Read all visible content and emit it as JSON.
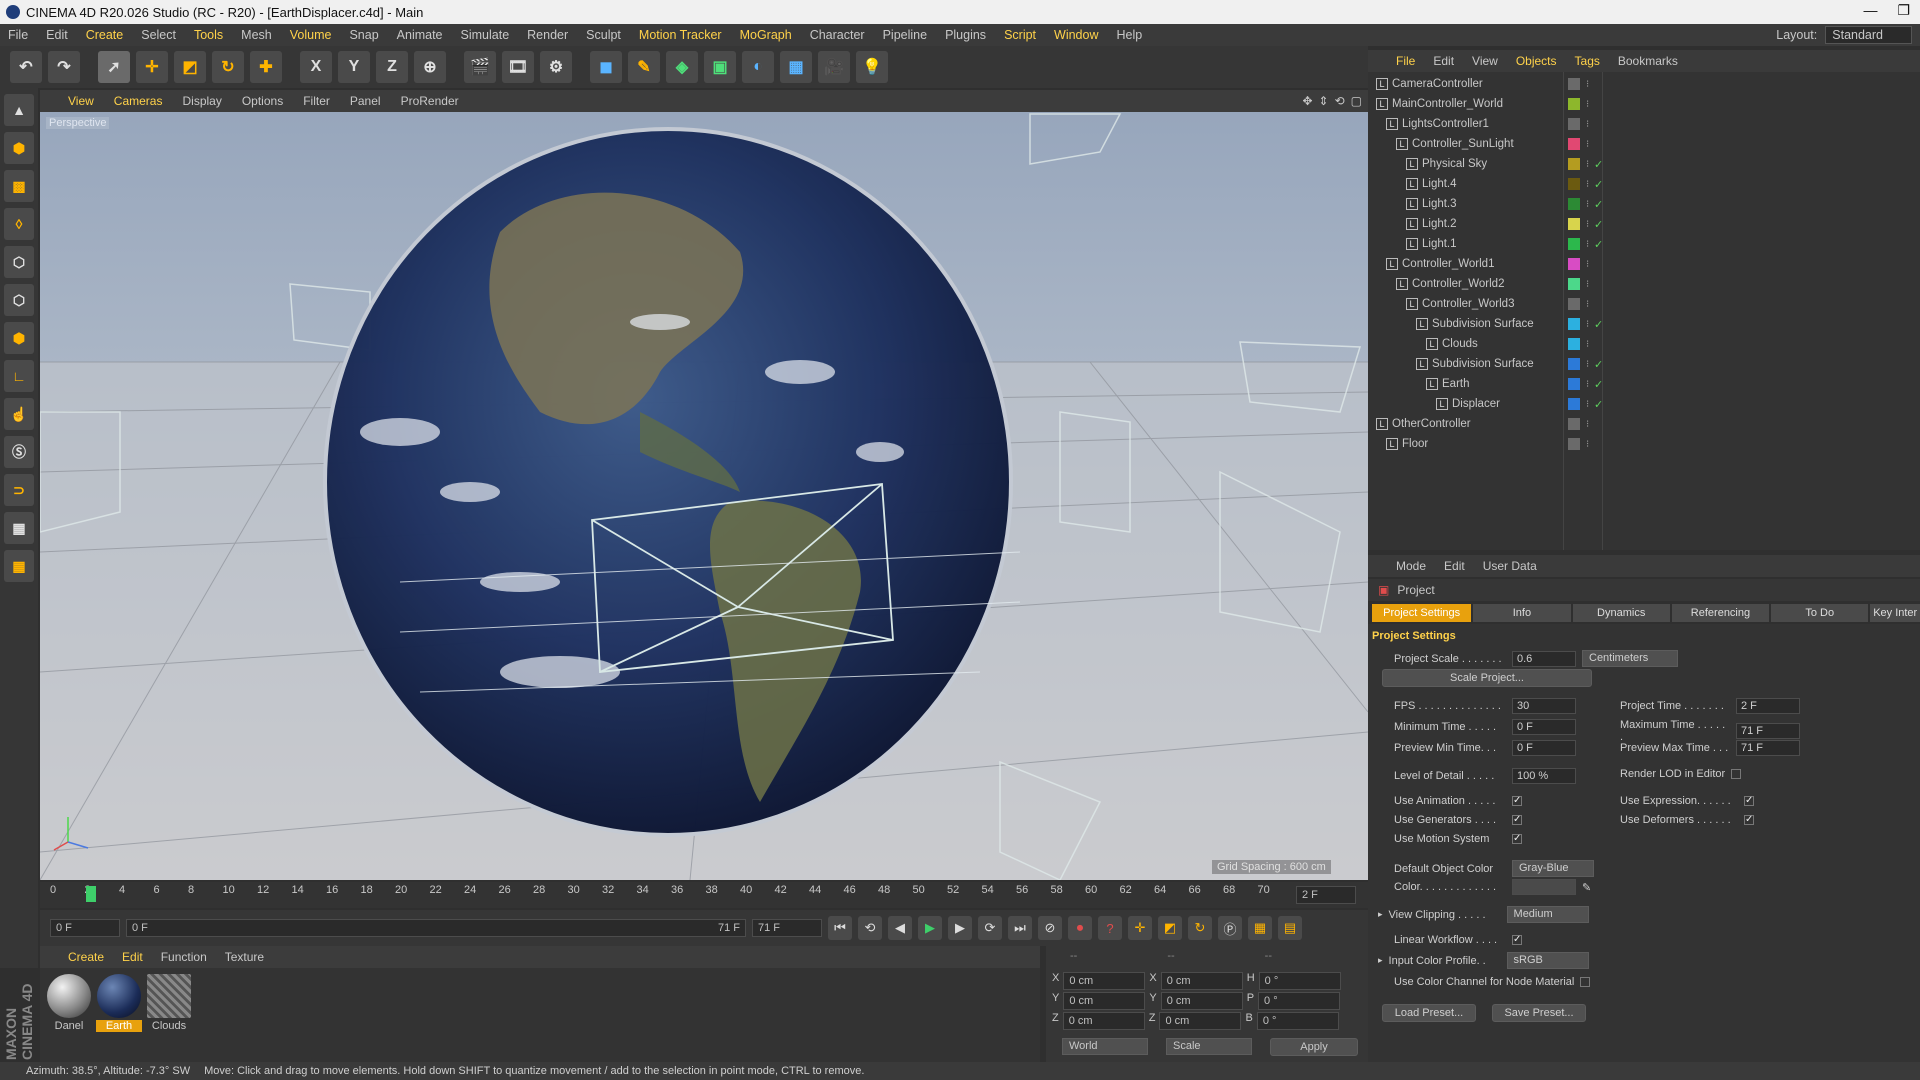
{
  "window": {
    "title": "CINEMA 4D R20.026 Studio (RC - R20) - [EarthDisplacer.c4d] - Main",
    "minimize": "—",
    "maximize": "❐"
  },
  "menubar": {
    "items": [
      "File",
      "Edit",
      "Create",
      "Select",
      "Tools",
      "Mesh",
      "Volume",
      "Snap",
      "Animate",
      "Simulate",
      "Render",
      "Sculpt",
      "Motion Tracker",
      "MoGraph",
      "Character",
      "Pipeline",
      "Plugins",
      "Script",
      "Window",
      "Help"
    ],
    "layout_label": "Layout:",
    "layout_value": "Standard"
  },
  "toolbar": {
    "x": "X",
    "y": "Y",
    "z": "Z"
  },
  "viewport": {
    "menu": [
      "View",
      "Cameras",
      "Display",
      "Options",
      "Filter",
      "Panel",
      "ProRender"
    ],
    "label": "Perspective",
    "grid_spacing": "Grid Spacing : 600 cm"
  },
  "timeline": {
    "ticks": [
      "0",
      "2",
      "4",
      "6",
      "8",
      "10",
      "12",
      "14",
      "16",
      "18",
      "20",
      "22",
      "24",
      "26",
      "28",
      "30",
      "32",
      "34",
      "36",
      "38",
      "40",
      "42",
      "44",
      "46",
      "48",
      "50",
      "52",
      "54",
      "56",
      "58",
      "60",
      "62",
      "64",
      "66",
      "68",
      "70"
    ],
    "current": "2 F"
  },
  "transport": {
    "start": "0 F",
    "range_start": "0 F",
    "range_end": "71 F",
    "end": "71 F"
  },
  "materials": {
    "menu": [
      "Create",
      "Edit",
      "Function",
      "Texture"
    ],
    "items": [
      {
        "name": "Danel",
        "selected": false
      },
      {
        "name": "Earth",
        "selected": true
      },
      {
        "name": "Clouds",
        "selected": false
      }
    ]
  },
  "coords": {
    "header": [
      "--",
      "--",
      "--"
    ],
    "rows": [
      {
        "a": "X",
        "av": "0 cm",
        "b": "X",
        "bv": "0 cm",
        "c": "H",
        "cv": "0 °"
      },
      {
        "a": "Y",
        "av": "0 cm",
        "b": "Y",
        "bv": "0 cm",
        "c": "P",
        "cv": "0 °"
      },
      {
        "a": "Z",
        "av": "0 cm",
        "b": "Z",
        "bv": "0 cm",
        "c": "B",
        "cv": "0 °"
      }
    ],
    "world": "World",
    "scale": "Scale",
    "apply": "Apply"
  },
  "status": {
    "orientation": "Azimuth: 38.5°, Altitude: -7.3°  SW",
    "hint": "Move: Click and drag to move elements. Hold down SHIFT to quantize movement / add to the selection in point mode, CTRL to remove."
  },
  "objects": {
    "menu": [
      "File",
      "Edit",
      "View",
      "Objects",
      "Tags",
      "Bookmarks"
    ],
    "items": [
      {
        "name": "CameraController",
        "depth": 0,
        "color": "#6a6a6a",
        "check": false
      },
      {
        "name": "MainController_World",
        "depth": 0,
        "color": "#8db72c",
        "check": false
      },
      {
        "name": "LightsController1",
        "depth": 1,
        "color": "#6a6a6a",
        "check": false
      },
      {
        "name": "Controller_SunLight",
        "depth": 2,
        "color": "#e14872",
        "check": false
      },
      {
        "name": "Physical Sky",
        "depth": 3,
        "color": "#b49c20",
        "check": true
      },
      {
        "name": "Light.4",
        "depth": 3,
        "color": "#6b5a10",
        "check": true
      },
      {
        "name": "Light.3",
        "depth": 3,
        "color": "#2c8a34",
        "check": true
      },
      {
        "name": "Light.2",
        "depth": 3,
        "color": "#d8d44c",
        "check": true
      },
      {
        "name": "Light.1",
        "depth": 3,
        "color": "#2cb84c",
        "check": true
      },
      {
        "name": "Controller_World1",
        "depth": 1,
        "color": "#d84cc4",
        "check": false
      },
      {
        "name": "Controller_World2",
        "depth": 2,
        "color": "#4cd88a",
        "check": false
      },
      {
        "name": "Controller_World3",
        "depth": 3,
        "color": "#6a6a6a",
        "check": false
      },
      {
        "name": "Subdivision Surface",
        "depth": 4,
        "color": "#2cb0e0",
        "check": true
      },
      {
        "name": "Clouds",
        "depth": 5,
        "color": "#2cb0e0",
        "check": false
      },
      {
        "name": "Subdivision Surface",
        "depth": 4,
        "color": "#2c7ad8",
        "check": true
      },
      {
        "name": "Earth",
        "depth": 5,
        "color": "#2c7ad8",
        "check": true
      },
      {
        "name": "Displacer",
        "depth": 6,
        "color": "#2c7ad8",
        "check": true
      },
      {
        "name": "OtherController",
        "depth": 0,
        "color": "#6a6a6a",
        "check": false
      },
      {
        "name": "Floor",
        "depth": 1,
        "color": "#6a6a6a",
        "check": false
      }
    ]
  },
  "attributes": {
    "menu": [
      "Mode",
      "Edit",
      "User Data"
    ],
    "object": "Project",
    "tabs": [
      "Project Settings",
      "Info",
      "Dynamics",
      "Referencing",
      "To Do",
      "Key Inter"
    ],
    "section": "Project Settings",
    "project_scale_label": "Project Scale . . . . . . .",
    "project_scale": "0.6",
    "project_scale_unit": "Centimeters",
    "scale_project_btn": "Scale Project...",
    "fps_label": "FPS . . . . . . . . . . . . . .",
    "fps": "30",
    "project_time_label": "Project Time . . . . . . .",
    "project_time": "2 F",
    "min_time_label": "Minimum Time . . . . .",
    "min_time": "0 F",
    "max_time_label": "Maximum Time . . . . . .",
    "max_time": "71 F",
    "prev_min_label": "Preview Min Time. . .",
    "prev_min": "0 F",
    "prev_max_label": "Preview Max Time . . .",
    "prev_max": "71 F",
    "lod_label": "Level of Detail . . . . .",
    "lod": "100 %",
    "render_lod_label": "Render LOD in Editor",
    "use_animation_label": "Use Animation . . . . .",
    "use_expression_label": "Use Expression. . . . . .",
    "use_generators_label": "Use Generators . . . .",
    "use_deformers_label": "Use Deformers . . . . . .",
    "use_motion_label": "Use Motion System",
    "default_color_label": "Default Object Color",
    "default_color": "Gray-Blue",
    "color_label": "Color. . . . . . . . . . . . .",
    "view_clipping_label": "View Clipping . . . . .",
    "view_clipping": "Medium",
    "linear_workflow_label": "Linear Workflow . . . .",
    "input_profile_label": "Input Color Profile. .",
    "input_profile": "sRGB",
    "node_material_label": "Use Color Channel for Node Material",
    "load_preset": "Load Preset...",
    "save_preset": "Save Preset...",
    "checkmark": "✓"
  },
  "branding": {
    "maxon": "MAXON CINEMA 4D"
  },
  "colors": {
    "accent": "#e8a10d",
    "menu_highlight": "#ffd24a",
    "check": "#5ed15e"
  }
}
